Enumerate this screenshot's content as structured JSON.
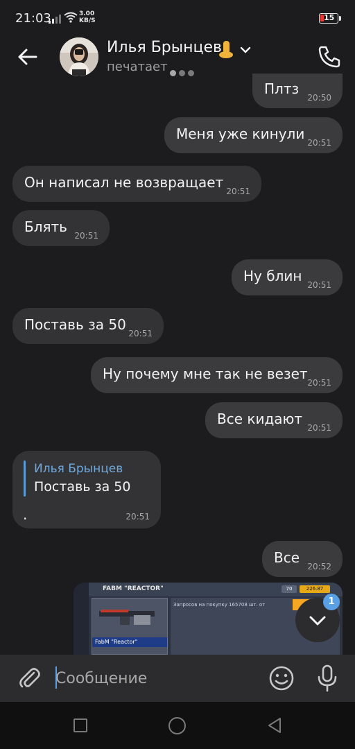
{
  "status_bar": {
    "time": "21:03",
    "speed_value": "3.00",
    "speed_unit": "KB/S",
    "battery": "15"
  },
  "header": {
    "contact_name": "Илья Брынцев",
    "name_emoji": "foot-emoji",
    "status": "печатает"
  },
  "messages": [
    {
      "id": "m1",
      "direction": "out",
      "text": "Плтз",
      "time": "20:50"
    },
    {
      "id": "m2",
      "direction": "out",
      "text": "Меня уже кинули",
      "time": "20:51"
    },
    {
      "id": "m3",
      "direction": "in",
      "text": "Он написал не возвращает",
      "time": "20:51"
    },
    {
      "id": "m4",
      "direction": "in",
      "text": "Блять",
      "time": "20:51"
    },
    {
      "id": "m5",
      "direction": "out",
      "text": "Ну блин",
      "time": "20:51"
    },
    {
      "id": "m6",
      "direction": "in",
      "text": "Поставь за 50",
      "time": "20:51"
    },
    {
      "id": "m7",
      "direction": "out",
      "text": "Ну почему мне так не везет",
      "time": "20:51"
    },
    {
      "id": "m8",
      "direction": "out",
      "text": "Все кидают",
      "time": "20:51"
    },
    {
      "id": "m10",
      "direction": "out",
      "text": "Все",
      "time": "20:52"
    }
  ],
  "reply_message": {
    "quoted_author": "Илья Брынцев",
    "quoted_text": "Поставь за 50",
    "text": ".",
    "time": "20:51"
  },
  "image_message": {
    "title": "FABM \"REACTOR\"",
    "card_label": "FabM \"Reactor\"",
    "panel_text": "Запросов на покупку 165708 шт. от",
    "chip_1": "70",
    "chip_2": "226.87",
    "description": "game market screenshot preview"
  },
  "scroll_fab": {
    "badge": "1"
  },
  "input": {
    "placeholder": "Сообщение"
  },
  "colors": {
    "background": "#1c1c1e",
    "bubble": "#3b3b3d",
    "accent": "#5aa0e6",
    "reply_author": "#6fa8dc"
  }
}
